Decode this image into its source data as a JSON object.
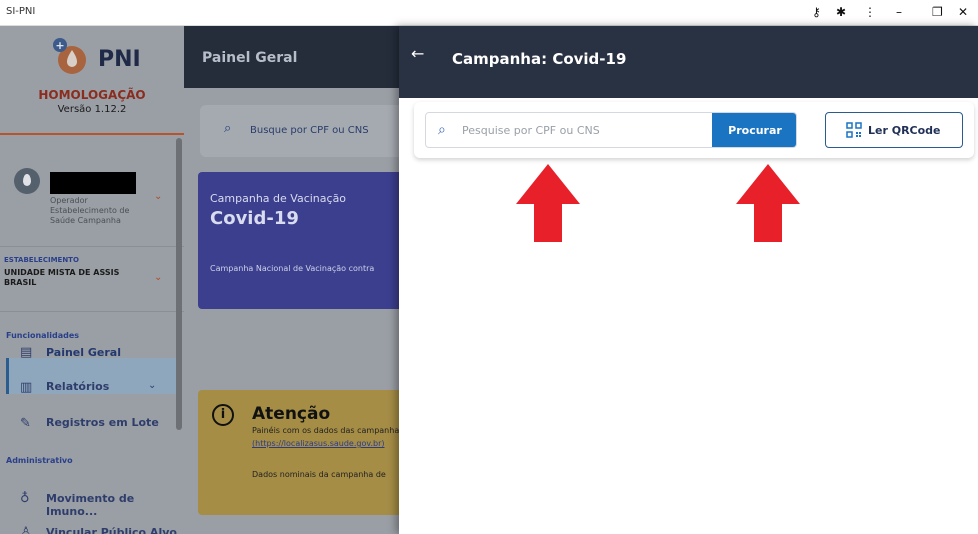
{
  "window": {
    "title": "SI-PNI"
  },
  "sidebar": {
    "logo_text": "PNI",
    "environment": "HOMOLOGAÇÃO",
    "version": "Versão 1.12.2",
    "operator": {
      "role": "Operador",
      "establishment": "Estabelecimento de Saúde Campanha"
    },
    "establishment_label": "ESTABELECIMENTO",
    "establishment_value": "UNIDADE MISTA DE ASSIS BRASIL",
    "section_features": "Funcionalidades",
    "nav": [
      {
        "label": "Painel Geral",
        "icon": "dashboard-icon",
        "active": true
      },
      {
        "label": "Relatórios",
        "icon": "reports-icon"
      },
      {
        "label": "Registros em Lote",
        "icon": "syringe-icon"
      }
    ],
    "section_admin": "Administrativo",
    "admin_nav": [
      {
        "label": "Movimento de Imuno...",
        "icon": "vaccine-hand-icon"
      },
      {
        "label": "Vincular Público Alvo",
        "icon": "person-icon"
      }
    ]
  },
  "main": {
    "header_title": "Painel Geral",
    "search_placeholder": "Busque por CPF ou CNS",
    "campaign_card": {
      "kicker": "Campanha de Vacinação",
      "title": "Covid-19",
      "description": "Campanha Nacional de Vacinação contra"
    },
    "notice": {
      "title": "Atenção",
      "line1": "Painéis com os dados das campanhas",
      "link": "(https://localizasus.saude.gov.br)",
      "line3": "Dados nominais da campanha de"
    }
  },
  "drawer": {
    "title": "Campanha: Covid-19",
    "search_placeholder": "Pesquise por CPF ou CNS",
    "search_button": "Procurar",
    "qr_button": "Ler QRCode"
  },
  "colors": {
    "drawer_header": "#283242",
    "primary_button": "#1a74c2",
    "annotation_arrow": "#e8202a"
  }
}
